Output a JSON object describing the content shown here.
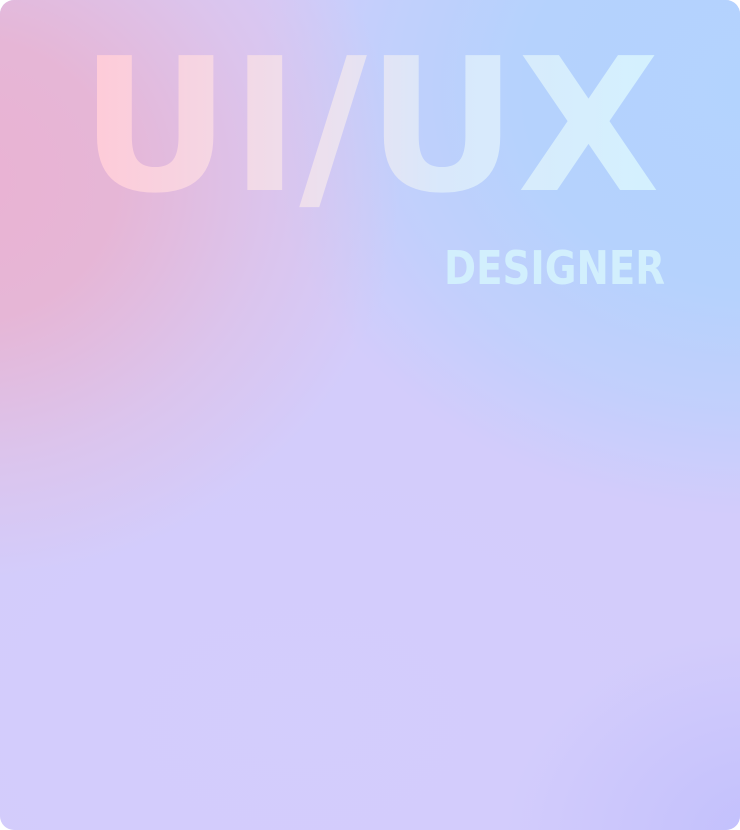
{
  "headline": {
    "title": "UI/UX",
    "subtitle": "DESIGNER"
  },
  "colors": {
    "pink": "#ffcad7",
    "blue_light": "#d4f1fe",
    "subtitle": "#d2effd",
    "bg_pink": "#eab2d3",
    "bg_blue": "#b3d3fe",
    "bg_lavender": "#d3ccfb"
  }
}
